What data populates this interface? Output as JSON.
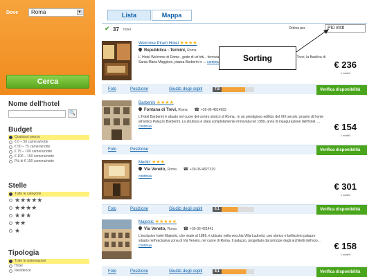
{
  "search": {
    "dove_label": "Dove",
    "city_value": "Roma",
    "cerca_label": "Cerca"
  },
  "filters": {
    "name_title": "Nome dell'hotel",
    "budget_title": "Budget",
    "budget_options": [
      {
        "label": "Qualsiasi prezzo",
        "selected": true
      },
      {
        "label": "€ 0 – 50 camera/notte",
        "selected": false
      },
      {
        "label": "€ 50 – 75 camera/notte",
        "selected": false
      },
      {
        "label": "€ 75 – 100 camera/notte",
        "selected": false
      },
      {
        "label": "€ 100 – 150 camera/notte",
        "selected": false
      },
      {
        "label": "Più di € 150 camera/notte",
        "selected": false
      }
    ],
    "stelle_title": "Stelle",
    "stelle_options": [
      {
        "label": "Tutte le categorie",
        "selected": true
      },
      {
        "label": "★★★★★",
        "selected": false
      },
      {
        "label": "★★★★",
        "selected": false
      },
      {
        "label": "★★★",
        "selected": false
      },
      {
        "label": "★★",
        "selected": false
      },
      {
        "label": "★",
        "selected": false
      }
    ],
    "tipologia_title": "Tipologia",
    "tipologia_options": [
      {
        "label": "Tutte le sistemazioni",
        "selected": true
      },
      {
        "label": "Hotel",
        "selected": false
      },
      {
        "label": "Residence",
        "selected": false
      }
    ]
  },
  "tabs": {
    "lista": "Lista",
    "mappa": "Mappa"
  },
  "results": {
    "count": "37",
    "count_label": "hotel",
    "order_label": "Ordina per",
    "order_value": "Più visti"
  },
  "callout": {
    "text": "Sorting"
  },
  "hotels": [
    {
      "name": "Welcome Piram Hotel",
      "stars": "★★★★",
      "area": "Repubblica - Termini,",
      "city": "Roma",
      "phone": "",
      "desc": "L' Hotel Welcome di Roma , gode di un'otti... ferroviaria di Roma-Termini, e da molte de... la Fontana di Trevi, la Basilica di Santa Maria Maggiore, piazza Barberini e ...",
      "more": "continua",
      "price": "€ 236",
      "price_sub": "1 notte/i",
      "foto": "Foto",
      "posizione": "Posizione",
      "giudizi": "Giudizi degli ospiti",
      "score": "7,8",
      "score_fill": 0.78,
      "verifica": "Verifica disponibilità"
    },
    {
      "name": "Barberini",
      "stars": "★★★★",
      "area": "Fontana di Trevi,",
      "city": "Roma",
      "phone": "+39-06-4814993",
      "desc": "L'Hotel Barberini è situato nel cuore del centro storico di Roma , in un prestigioso edificio del XIX secolo, proprio di fronte all'antico Palazzo Barberini. La struttura è stata completamente rinnovata nel 1999, anno di inaugurazione dell'hotel. ...",
      "more": "continua",
      "price": "€ 154",
      "price_sub": "1 notte/i",
      "foto": "Foto",
      "posizione": "Posizione",
      "giudizi": "",
      "score": "",
      "score_fill": 0,
      "verifica": "Verifica disponibilità"
    },
    {
      "name": "Medici",
      "stars": "★★★",
      "area": "Via Veneto,",
      "city": "Roma",
      "phone": "+39-06-4827319",
      "desc": "",
      "more": "continua",
      "price": "€ 301",
      "price_sub": "1 notte/i",
      "foto": "Foto",
      "posizione": "Posizione",
      "giudizi": "Giudizi degli ospiti",
      "score": "6,1",
      "score_fill": 0.61,
      "verifica": "Verifica disponibilità"
    },
    {
      "name": "Majestic",
      "stars": "★★★★★",
      "area": "Via Veneto,",
      "city": "Roma",
      "phone": "+39-06-421441",
      "desc": "L'esclusivo hotel Majestic, che risale al 1889, è ubicato nella vecchia Villa Ludovisi, uno storico e bellissimo palazzo situato nell'esclusiva zona di Via Veneto, nel cuore di Roma. Il palazzo, progettato dal principe degli architetti dell'epo... ",
      "more": "continua",
      "price": "€ 158",
      "price_sub": "1 notte/i",
      "foto": "Foto",
      "posizione": "Posizione",
      "giudizi": "Giudizi degli ospiti",
      "score": "8,1",
      "score_fill": 0.81,
      "verifica": "Verifica disponibilità"
    }
  ]
}
